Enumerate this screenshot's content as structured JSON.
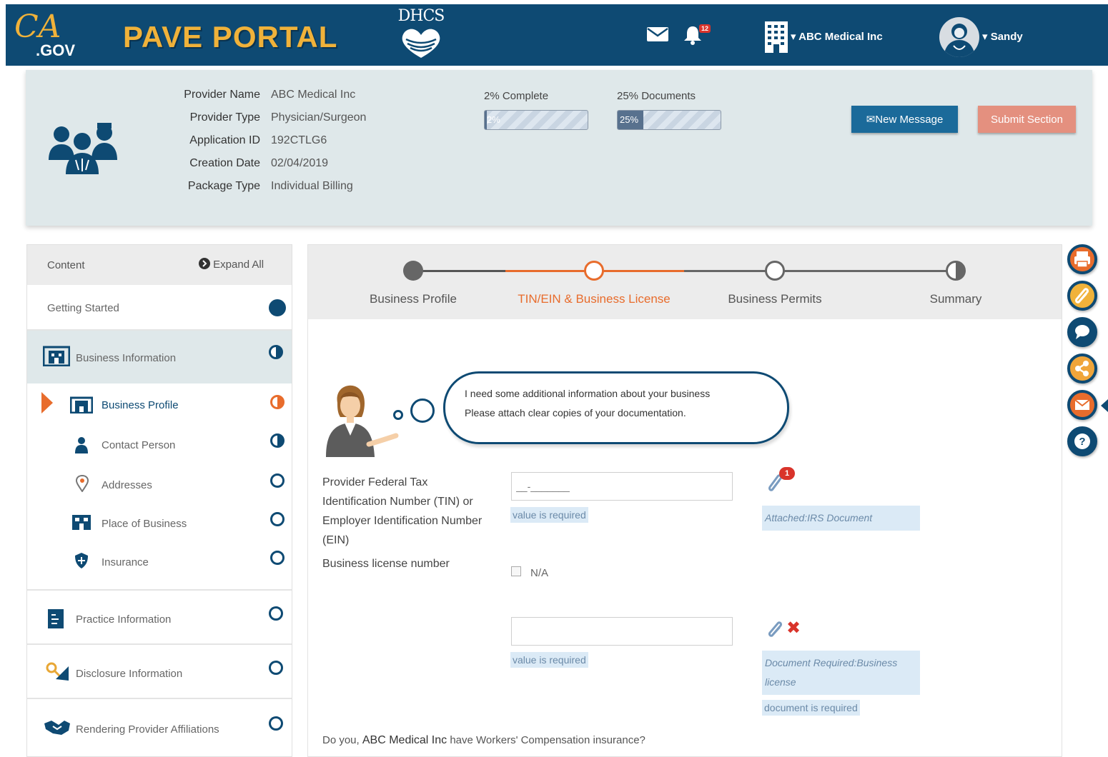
{
  "header": {
    "ca_logo": "CA",
    "ca_gov": ".GOV",
    "brand": "PAVE PORTAL",
    "dhcs": "DHCS",
    "notification_count": "12",
    "org_name": "ABC Medical Inc",
    "user_name": "Sandy"
  },
  "provider": {
    "fields": [
      {
        "label": "Provider Name",
        "value": "ABC Medical Inc"
      },
      {
        "label": "Provider Type",
        "value": "Physician/Surgeon"
      },
      {
        "label": "Application ID",
        "value": "192CTLG6"
      },
      {
        "label": "Creation Date",
        "value": "02/04/2019"
      },
      {
        "label": "Package Type",
        "value": "Individual Billing"
      }
    ],
    "complete_label": "2% Complete",
    "complete_value": "2%",
    "complete_pct": 2,
    "documents_label": "25% Documents",
    "documents_value": "25%",
    "documents_pct": 25,
    "new_message": "New Message",
    "submit_section": "Submit Section"
  },
  "sidebar": {
    "content_label": "Content",
    "expand_all": "Expand All",
    "getting_started": "Getting Started",
    "business_information": "Business Information",
    "sub_items": [
      {
        "label": "Business Profile",
        "status": "half-orange"
      },
      {
        "label": "Contact Person",
        "status": "half"
      },
      {
        "label": "Addresses",
        "status": "empty"
      },
      {
        "label": "Place of Business",
        "status": "empty"
      },
      {
        "label": "Insurance",
        "status": "empty"
      }
    ],
    "practice_information": "Practice Information",
    "disclosure_information": "Disclosure Information",
    "rendering_provider": "Rendering Provider Affiliations"
  },
  "steps": [
    {
      "label": "Business Profile",
      "state": "done"
    },
    {
      "label": "TIN/EIN & Business License",
      "state": "active"
    },
    {
      "label": "Business Permits",
      "state": "empty"
    },
    {
      "label": "Summary",
      "state": "half"
    }
  ],
  "assistant": {
    "line1": "I need some additional information about your business",
    "line2": "Please attach clear copies of your documentation."
  },
  "form": {
    "tin_label": "Provider Federal Tax Identification Number (TIN) or Employer Identification Number (EIN)",
    "tin_placeholder": "__-_______",
    "value_required": "value is required",
    "attachment_count": "1",
    "attached_note": "Attached:IRS Document",
    "license_label": "Business license number",
    "na_label": "N/A",
    "doc_required_note": "Document Required:Business license",
    "doc_is_required": "document is required",
    "workers_comp_prefix": "Do you,",
    "workers_comp_org": "ABC Medical Inc",
    "workers_comp_suffix": "have Workers' Compensation insurance?"
  },
  "colors": {
    "navy": "#0e4a73",
    "gold": "#f0b23a",
    "orange": "#e86c2c",
    "salmon": "#e4907f"
  }
}
